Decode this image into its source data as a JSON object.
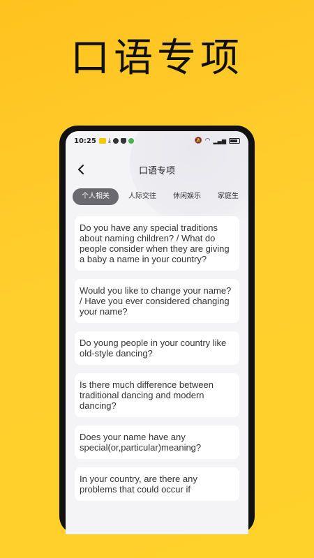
{
  "promo": {
    "title": "口语专项"
  },
  "status_bar": {
    "time": "10:25"
  },
  "header": {
    "title": "口语专项"
  },
  "tabs": [
    {
      "label": "个人相关",
      "active": true
    },
    {
      "label": "人际交往",
      "active": false
    },
    {
      "label": "休闲娱乐",
      "active": false
    },
    {
      "label": "家庭生",
      "active": false
    }
  ],
  "questions": [
    {
      "text": "Do you have any special traditions about naming children? / What do people consider when they are giving a baby a name in your country?"
    },
    {
      "text": "Would you like to change your name? / Have you ever considered changing your name?"
    },
    {
      "text": "Do young people in your country like old-style dancing?"
    },
    {
      "text": "Is there much difference between traditional dancing and modern dancing?"
    },
    {
      "text": "Does your name have any special(or,particular)meaning?"
    },
    {
      "text": "In your country, are there any problems that could occur if"
    }
  ],
  "colors": {
    "background": "#ffc21f",
    "active_tab": "#6a6a6e",
    "card": "#ffffff"
  }
}
